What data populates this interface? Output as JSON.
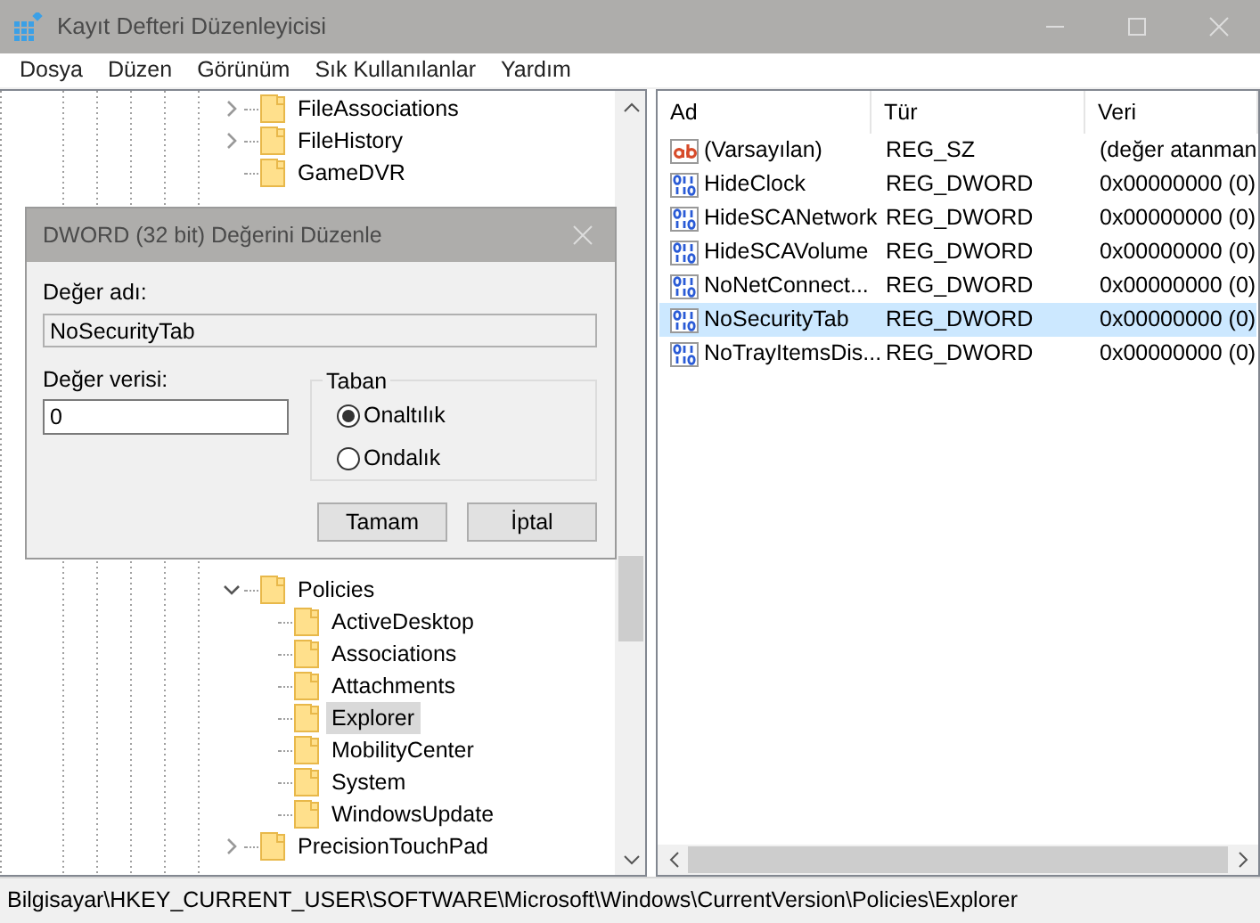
{
  "window": {
    "title": "Kayıt Defteri Düzenleyicisi"
  },
  "menu": [
    "Dosya",
    "Düzen",
    "Görünüm",
    "Sık Kullanılanlar",
    "Yardım"
  ],
  "tree": {
    "items": [
      {
        "label": "FileAssociations",
        "expanded": false,
        "selected": false
      },
      {
        "label": "FileHistory",
        "expanded": false,
        "selected": false
      },
      {
        "label": "GameDVR",
        "selected": false
      },
      {
        "label": "Policies",
        "expanded": true,
        "selected": false,
        "children": [
          {
            "label": "ActiveDesktop",
            "selected": false
          },
          {
            "label": "Associations",
            "selected": false
          },
          {
            "label": "Attachments",
            "selected": false
          },
          {
            "label": "Explorer",
            "selected": true
          },
          {
            "label": "MobilityCenter",
            "selected": false
          },
          {
            "label": "System",
            "selected": false
          },
          {
            "label": "WindowsUpdate",
            "selected": false
          }
        ]
      },
      {
        "label": "PrecisionTouchPad",
        "expanded": false,
        "selected": false
      }
    ]
  },
  "values": {
    "columns": [
      "Ad",
      "Tür",
      "Veri"
    ],
    "rows": [
      {
        "kind": "string",
        "name": "(Varsayılan)",
        "type": "REG_SZ",
        "data": "(değer atanman",
        "selected": false
      },
      {
        "kind": "binary",
        "name": "HideClock",
        "type": "REG_DWORD",
        "data": "0x00000000 (0)",
        "selected": false
      },
      {
        "kind": "binary",
        "name": "HideSCANetwork",
        "type": "REG_DWORD",
        "data": "0x00000000 (0)",
        "selected": false
      },
      {
        "kind": "binary",
        "name": "HideSCAVolume",
        "type": "REG_DWORD",
        "data": "0x00000000 (0)",
        "selected": false
      },
      {
        "kind": "binary",
        "name": "NoNetConnect...",
        "type": "REG_DWORD",
        "data": "0x00000000 (0)",
        "selected": false
      },
      {
        "kind": "binary",
        "name": "NoSecurityTab",
        "type": "REG_DWORD",
        "data": "0x00000000 (0)",
        "selected": true
      },
      {
        "kind": "binary",
        "name": "NoTrayItemsDis...",
        "type": "REG_DWORD",
        "data": "0x00000000 (0)",
        "selected": false
      }
    ]
  },
  "dialog": {
    "title": "DWORD (32 bit) Değerini Düzenle",
    "name_label": "Değer adı:",
    "name_value": "NoSecurityTab",
    "data_label": "Değer verisi:",
    "data_value": "0",
    "base_title": "Taban",
    "base_options": [
      {
        "label": "Onaltılık",
        "selected": true
      },
      {
        "label": "Ondalık",
        "selected": false
      }
    ],
    "buttons": [
      "Tamam",
      "İptal"
    ]
  },
  "status_bar": "Bilgisayar\\HKEY_CURRENT_USER\\SOFTWARE\\Microsoft\\Windows\\CurrentVersion\\Policies\\Explorer"
}
